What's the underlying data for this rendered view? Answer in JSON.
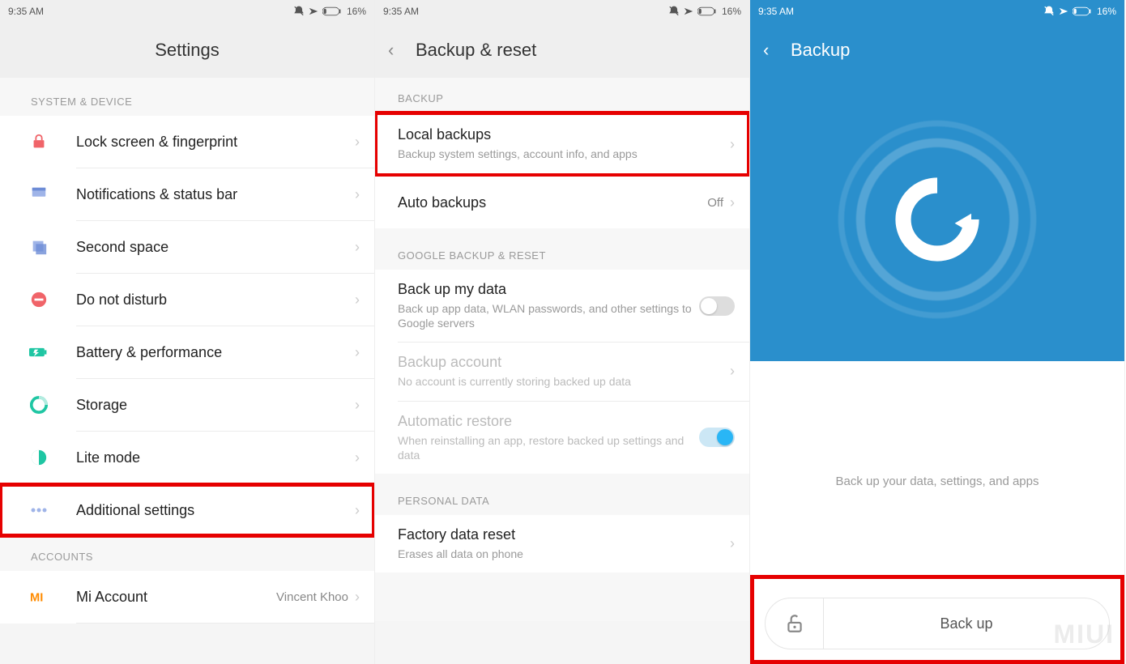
{
  "status": {
    "time": "9:35 AM",
    "battery": "16%"
  },
  "phone1": {
    "title": "Settings",
    "section1": "SYSTEM & DEVICE",
    "items": [
      {
        "label": "Lock screen & fingerprint"
      },
      {
        "label": "Notifications & status bar"
      },
      {
        "label": "Second space"
      },
      {
        "label": "Do not disturb"
      },
      {
        "label": "Battery & performance"
      },
      {
        "label": "Storage"
      },
      {
        "label": "Lite mode"
      },
      {
        "label": "Additional settings"
      }
    ],
    "section2": "ACCOUNTS",
    "account": {
      "label": "Mi Account",
      "value": "Vincent Khoo"
    }
  },
  "phone2": {
    "title": "Backup & reset",
    "sectionBackup": "BACKUP",
    "localBackups": {
      "label": "Local backups",
      "sub": "Backup system settings, account info, and apps"
    },
    "autoBackups": {
      "label": "Auto backups",
      "value": "Off"
    },
    "sectionGoogle": "GOOGLE BACKUP & RESET",
    "backupMyData": {
      "label": "Back up my data",
      "sub": "Back up app data, WLAN passwords, and other settings to Google servers"
    },
    "backupAccount": {
      "label": "Backup account",
      "sub": "No account is currently storing backed up data"
    },
    "autoRestore": {
      "label": "Automatic restore",
      "sub": "When reinstalling an app, restore backed up settings and data"
    },
    "sectionPersonal": "PERSONAL DATA",
    "factoryReset": {
      "label": "Factory data reset",
      "sub": "Erases all data on phone"
    }
  },
  "phone3": {
    "title": "Backup",
    "caption": "Back up your data, settings, and apps",
    "button": "Back up"
  },
  "watermark": "MIUI"
}
